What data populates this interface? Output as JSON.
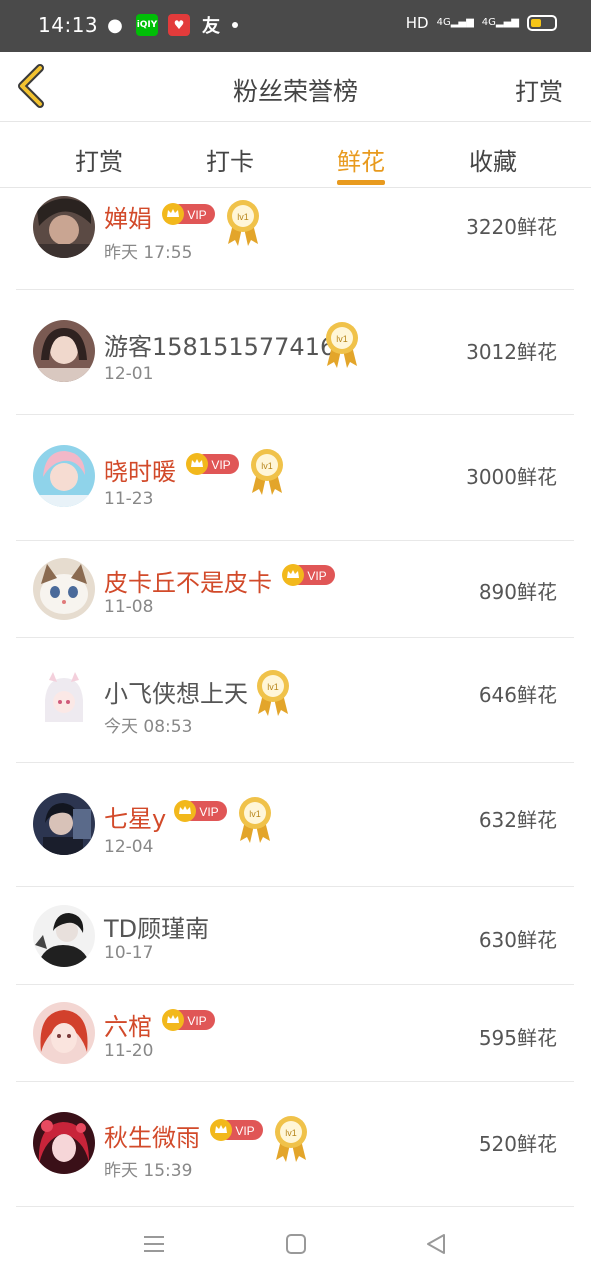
{
  "status_bar": {
    "time": "14:13",
    "iqiyi_label": "iQIY",
    "friend_label": "友",
    "hd_label": "HD",
    "net1_label": "4G",
    "net2_label": "4G",
    "battery_color": "#f5c518"
  },
  "header": {
    "title": "粉丝荣誉榜",
    "action_label": "打赏",
    "back_icon": "chevron-left-icon"
  },
  "tabs": [
    {
      "label": "打赏",
      "active": false
    },
    {
      "label": "打卡",
      "active": false
    },
    {
      "label": "鲜花",
      "active": true
    },
    {
      "label": "收藏",
      "active": false
    }
  ],
  "badges": {
    "vip_label": "VIP",
    "medal_label": "lv1"
  },
  "rows": [
    {
      "name": "婵娟",
      "date": "昨天 17:55",
      "amount": "3220鲜花",
      "vip": true,
      "medal": true
    },
    {
      "name": "游客158151577416",
      "date": "12-01",
      "amount": "3012鲜花",
      "vip": false,
      "medal": true
    },
    {
      "name": "晓时暖",
      "date": "11-23",
      "amount": "3000鲜花",
      "vip": true,
      "medal": true
    },
    {
      "name": "皮卡丘不是皮卡",
      "date": "11-08",
      "amount": "890鲜花",
      "vip": true,
      "medal": false
    },
    {
      "name": "小飞侠想上天",
      "date": "今天 08:53",
      "amount": "646鲜花",
      "vip": false,
      "medal": true
    },
    {
      "name": "七星y",
      "date": "12-04",
      "amount": "632鲜花",
      "vip": true,
      "medal": true
    },
    {
      "name": "TD顾瑾南",
      "date": "10-17",
      "amount": "630鲜花",
      "vip": false,
      "medal": false
    },
    {
      "name": "六棺",
      "date": "11-20",
      "amount": "595鲜花",
      "vip": true,
      "medal": false
    },
    {
      "name": "秋生微雨",
      "date": "昨天 15:39",
      "amount": "520鲜花",
      "vip": true,
      "medal": true
    }
  ],
  "colors": {
    "accent": "#e89a1e",
    "vip_name": "#d24a2a",
    "vip_badge": "#e05656",
    "crown": "#f2b81c"
  },
  "nav": {
    "menu_icon": "menu-icon",
    "home_icon": "square-home-icon",
    "back_icon": "triangle-back-icon"
  }
}
